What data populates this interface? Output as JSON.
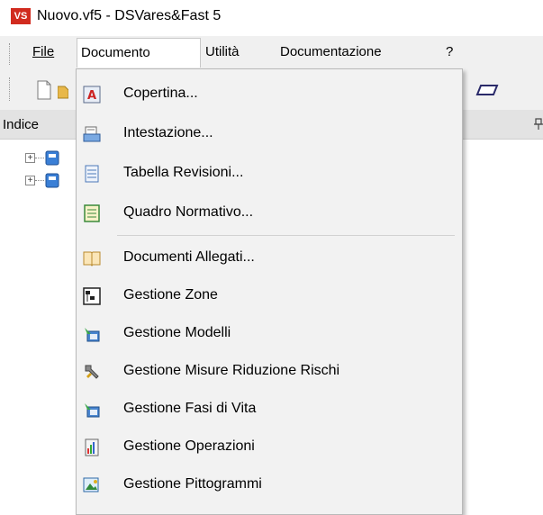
{
  "window": {
    "logo_text": "VS",
    "title": "Nuovo.vf5 - DSVares&Fast 5"
  },
  "menubar": {
    "items": [
      {
        "label": "File"
      },
      {
        "label": "Documento"
      },
      {
        "label": "Utilità"
      },
      {
        "label": "Documentazione"
      },
      {
        "label": "?"
      }
    ]
  },
  "panel": {
    "title": "Indice"
  },
  "dropdown": {
    "items": [
      {
        "label": "Copertina...",
        "icon": "cover-icon"
      },
      {
        "label": "Intestazione...",
        "icon": "header-icon"
      },
      {
        "label": "Tabella Revisioni...",
        "icon": "revision-table-icon"
      },
      {
        "label": "Quadro Normativo...",
        "icon": "regulatory-icon"
      },
      {
        "label": "Documenti Allegati...",
        "icon": "attachments-icon"
      },
      {
        "label": "Gestione Zone",
        "icon": "zones-icon"
      },
      {
        "label": "Gestione Modelli",
        "icon": "models-icon"
      },
      {
        "label": "Gestione Misure Riduzione Rischi",
        "icon": "risk-reduction-icon"
      },
      {
        "label": "Gestione Fasi di Vita",
        "icon": "life-phases-icon"
      },
      {
        "label": "Gestione Operazioni",
        "icon": "operations-icon"
      },
      {
        "label": "Gestione Pittogrammi",
        "icon": "pictograms-icon"
      }
    ]
  },
  "colors": {
    "logo": "#d12b1f",
    "menubar_bg": "#f0f0f0",
    "dropdown_bg": "#f2f2f2",
    "panel_header_bg": "#e3e3e3"
  }
}
